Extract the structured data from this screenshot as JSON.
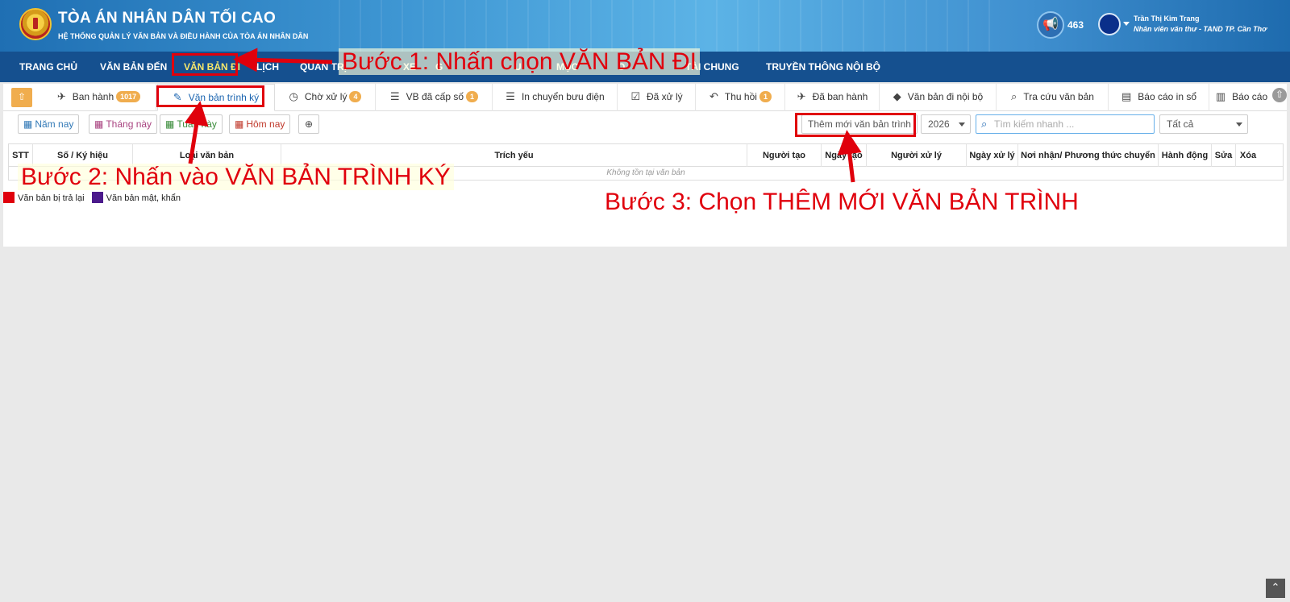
{
  "header": {
    "brand_title": "TÒA ÁN NHÂN DÂN TỐI CAO",
    "brand_sub": "HỆ THỐNG QUẢN LÝ VĂN BẢN VÀ ĐIỀU HÀNH CỦA TÒA ÁN NHÂN DÂN",
    "notification_count": "463",
    "user_name": "Trần Thị Kim Trang",
    "user_role": "Nhân viên văn thư - TAND TP. Cần Thơ",
    "logo_icon": "court-emblem-icon",
    "notification_icon": "megaphone-icon"
  },
  "nav": {
    "items": [
      "TRANG CHỦ",
      "VĂN BẢN ĐẾN",
      "VĂN BẢN ĐI",
      "LỊCH",
      "QUAN TRỊ",
      "XE",
      "G",
      "U",
      "MỤC",
      "O",
      "TÀI CHUNG",
      "TRUYỀN THÔNG NỘI BỘ"
    ],
    "active": "VĂN BẢN ĐI",
    "active_color": "#f5e66b"
  },
  "tabs": [
    {
      "icon": "paper-plane-icon",
      "glyph": "✈",
      "label": "Ban hành",
      "badge": "1017"
    },
    {
      "icon": "edit-icon",
      "glyph": "✎",
      "label": "Văn bản trình ký",
      "badge": ""
    },
    {
      "icon": "clock-icon",
      "glyph": "◷",
      "label": "Chờ xử lý",
      "badge": "4"
    },
    {
      "icon": "list-icon",
      "glyph": "☰",
      "label": "VB đã cấp số",
      "badge": "1"
    },
    {
      "icon": "list-icon",
      "glyph": "☰",
      "label": "In chuyển bưu điện",
      "badge": ""
    },
    {
      "icon": "check-square-icon",
      "glyph": "☑",
      "label": "Đã xử lý",
      "badge": ""
    },
    {
      "icon": "reply-all-icon",
      "glyph": "↶",
      "label": "Thu hồi",
      "badge": "1"
    },
    {
      "icon": "paper-plane-icon",
      "glyph": "✈",
      "label": "Đã ban hành",
      "badge": ""
    },
    {
      "icon": "tags-icon",
      "glyph": "◆",
      "label": "Văn bản đi nội bộ",
      "badge": ""
    },
    {
      "icon": "search-icon",
      "glyph": "⌕",
      "label": "Tra cứu văn bản",
      "badge": ""
    },
    {
      "icon": "book-icon",
      "glyph": "▤",
      "label": "Báo cáo in sổ",
      "badge": ""
    },
    {
      "icon": "bar-chart-icon",
      "glyph": "▥",
      "label": "Báo cáo",
      "badge": ""
    }
  ],
  "filters": {
    "year": {
      "icon": "calendar-icon",
      "label": "Năm nay",
      "color": "#337ab7"
    },
    "month": {
      "icon": "calendar-icon",
      "label": "Tháng này",
      "color": "#a94481"
    },
    "week": {
      "icon": "calendar-check-icon",
      "label": "Tuần này",
      "color": "#3c8d3c"
    },
    "today": {
      "icon": "calendar-icon",
      "label": "Hôm nay",
      "color": "#c0392b"
    },
    "zoom_icon": "zoom-icon"
  },
  "toolbar": {
    "add_label": "Thêm mới văn bản trình",
    "year_value": "2026",
    "search_placeholder": "Tìm kiếm nhanh ...",
    "scope_value": "Tất cả"
  },
  "table": {
    "columns": [
      "STT",
      "Số / Ký hiệu",
      "Loại văn bản",
      "Trích yếu",
      "Người tạo",
      "Ngày tạo",
      "Người xử lý",
      "Ngày xử lý",
      "Nơi nhận/ Phương thức chuyển",
      "Hành động",
      "Sửa",
      "Xóa"
    ],
    "empty_message": "Không tồn tại văn bản"
  },
  "legend": [
    {
      "label": "Văn bản bị trả lại",
      "color": "#e0000c"
    },
    {
      "label": "Văn bản mật, khẩn",
      "color": "#4b1a8c"
    }
  ],
  "annotations": {
    "step1": "Bước 1: Nhấn chọn VĂN BẢN ĐI",
    "step2": "Bước 2: Nhấn vào VĂN BẢN TRÌNH KÝ",
    "step3": "Bước 3: Chọn THÊM MỚI VĂN BẢN TRÌNH",
    "color": "#e0000c"
  }
}
